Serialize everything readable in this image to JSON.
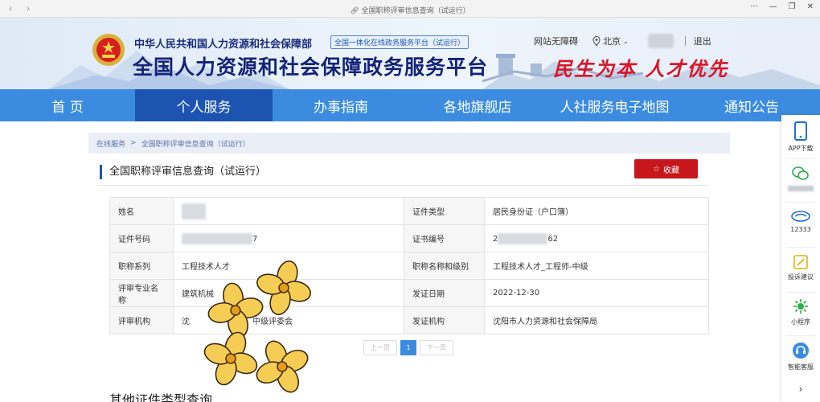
{
  "browser": {
    "title": "全国职称评审信息查询（试运行）",
    "menu": "···",
    "minimize": "—",
    "restore": "❐",
    "close": "✕"
  },
  "header": {
    "ministry": "中华人民共和国人力资源和社会保障部",
    "slogan_tag": "全国一体化在线政务服务平台（试运行）",
    "platform": "全国人力资源和社会保障政务服务平台",
    "calligraphy": "民生为本 人才优先",
    "accessibility": "网站无障碍",
    "location": "北京",
    "logout": "退出"
  },
  "nav": {
    "items": [
      {
        "label": "首 页",
        "active": false
      },
      {
        "label": "个人服务",
        "active": true
      },
      {
        "label": "办事指南",
        "active": false
      },
      {
        "label": "各地旗舰店",
        "active": false
      },
      {
        "label": "人社服务电子地图",
        "active": false
      },
      {
        "label": "通知公告",
        "active": false
      }
    ]
  },
  "breadcrumb": {
    "root": "在线服务",
    "sep": ">",
    "current": "全国职称评审信息查询（试运行）"
  },
  "section": {
    "title": "全国职称评审信息查询（试运行）",
    "favorite": "收藏"
  },
  "info": {
    "rows": [
      {
        "l1": "姓名",
        "v1": "",
        "l2": "证件类型",
        "v2": "居民身份证（户口簿）"
      },
      {
        "l1": "证件号码",
        "v1": "7",
        "l2": "证书编号",
        "v2": "2"
      },
      {
        "l1": "职称系列",
        "v1": "工程技术人才",
        "l2": "职称名称和级别",
        "v2": "工程技术人才_工程师-中级"
      },
      {
        "l1": "评审专业名称",
        "v1": "建筑机械",
        "l2": "发证日期",
        "v2": "2022-12-30"
      },
      {
        "l1": "评审机构",
        "v1": "沈",
        "l2": "发证机构",
        "v2": "沈阳市人力资源和社会保障局"
      }
    ],
    "id_tail": "7",
    "cert_head": "2",
    "cert_tail": "62",
    "org_tail": "中级评委会"
  },
  "pager": {
    "prev": "上一页",
    "current": "1",
    "next": "下一页"
  },
  "other": {
    "title": "其他证件类型查询"
  },
  "sidebar": {
    "app": "APP下载",
    "hotline": "12333",
    "complaint": "投诉建议",
    "miniprogram": "小程序",
    "service": "智能客服"
  },
  "colors": {
    "nav": "#3b8ce0",
    "nav_active": "#1d54b1",
    "favorite": "#c8161d",
    "title": "#13237a"
  }
}
